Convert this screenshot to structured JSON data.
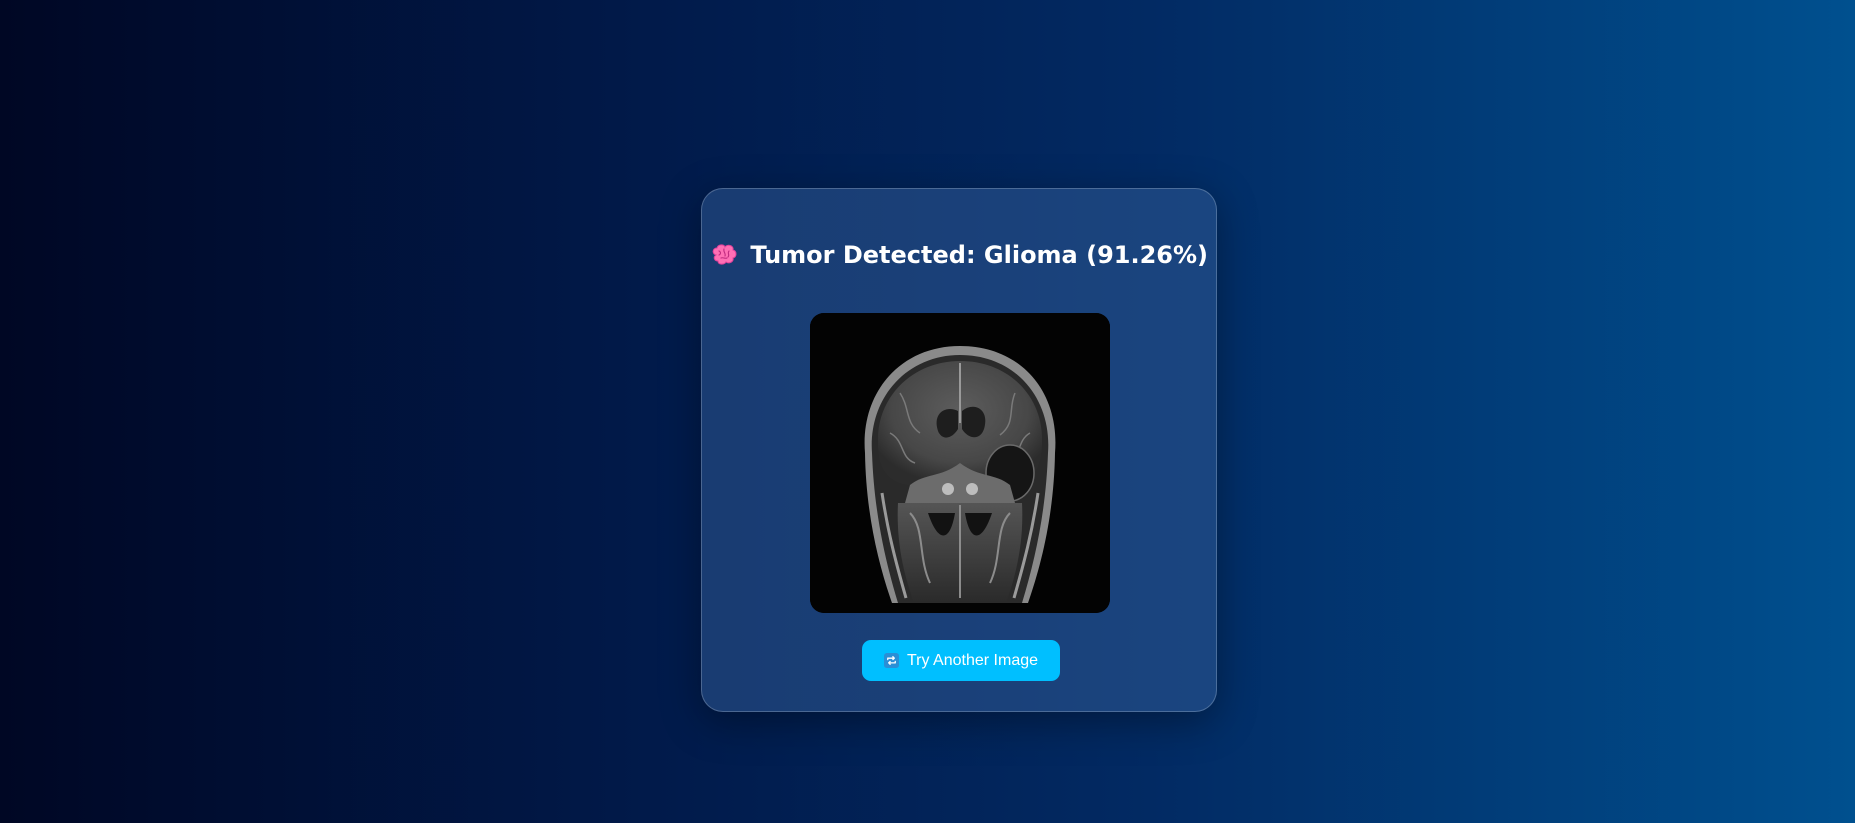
{
  "result": {
    "title": "Tumor Detected: Glioma (91.26%)",
    "icon": "brain-icon"
  },
  "scan_image": {
    "description_icon": "mri-scan-image"
  },
  "actions": {
    "retry_label": "Try Another Image",
    "retry_icon": "repeat-icon"
  },
  "colors": {
    "accent": "#00bfff",
    "card_background": "#2e4f80",
    "text": "#ffffff"
  }
}
